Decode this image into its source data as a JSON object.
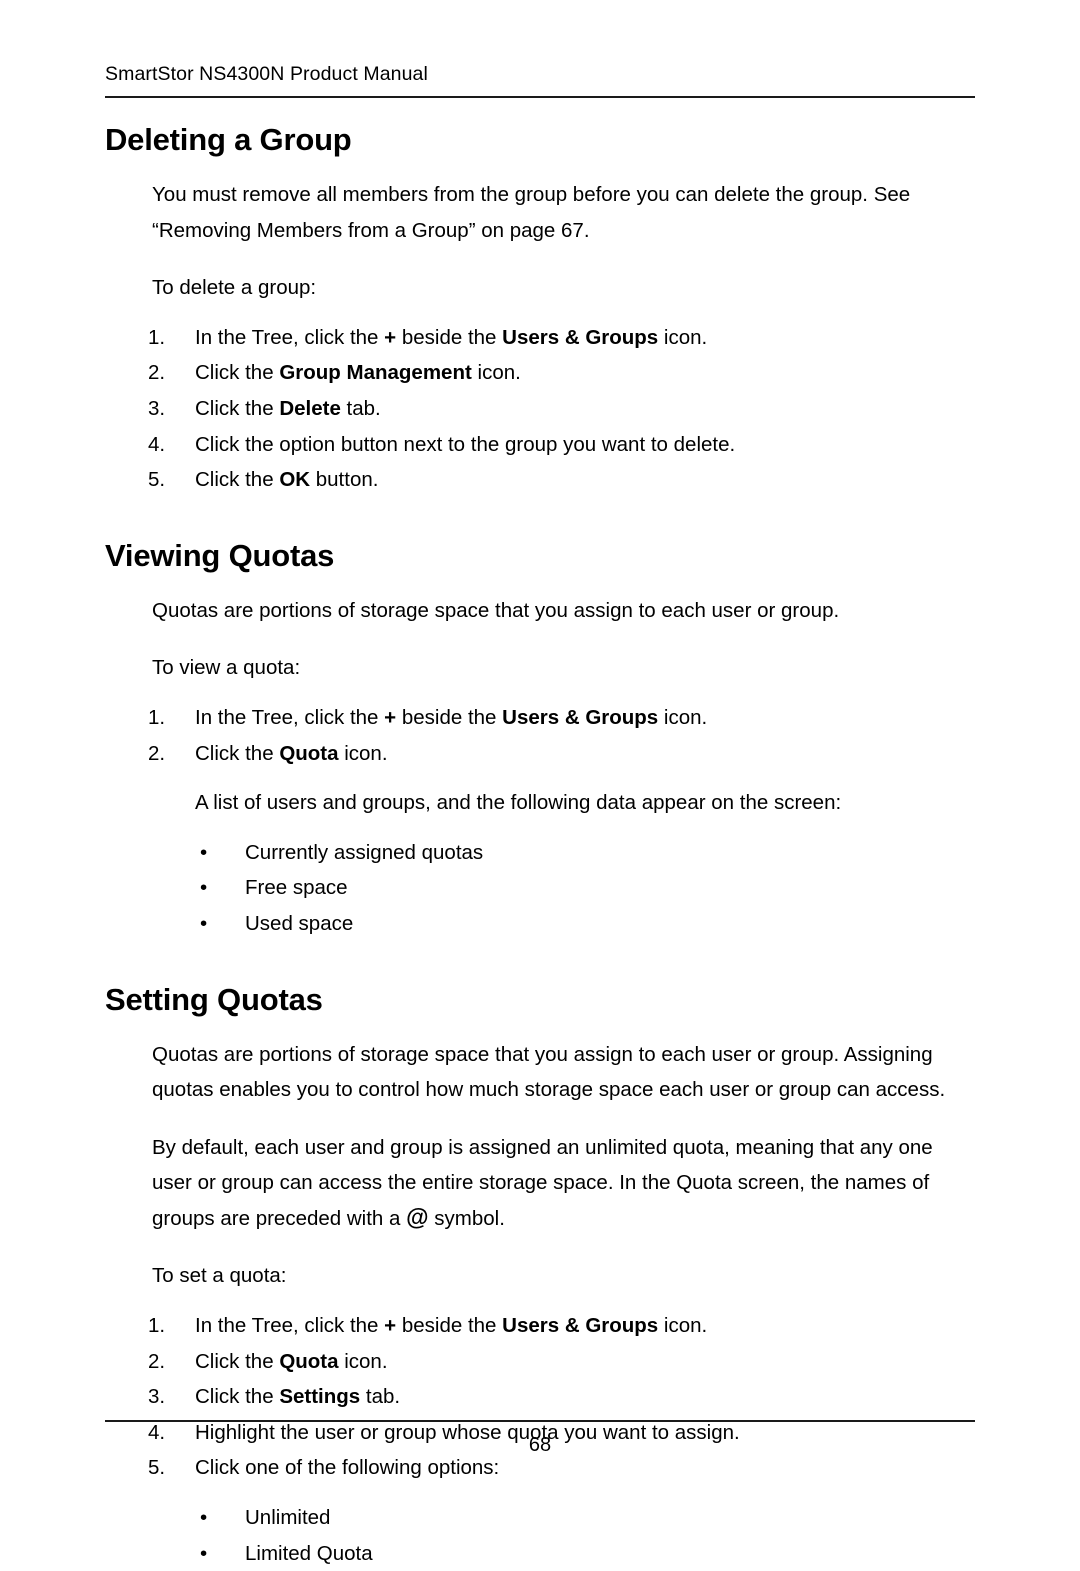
{
  "header": {
    "running_title": "SmartStor NS4300N Product Manual"
  },
  "footer": {
    "page_number": "68"
  },
  "sections": [
    {
      "heading": "Deleting a Group",
      "intro": "You must remove all members from the group before you can delete the group. See “Removing Members from a Group” on page 67.",
      "lead_in": "To delete a group:",
      "steps": [
        {
          "num": "1.",
          "pre": "In the Tree, click the ",
          "bold": "+",
          "mid": " beside the ",
          "bold2": "Users & Groups",
          "post": " icon."
        },
        {
          "num": "2.",
          "pre": "Click the ",
          "bold": "Group Management",
          "post": " icon."
        },
        {
          "num": "3.",
          "pre": "Click the ",
          "bold": "Delete",
          "post": " tab."
        },
        {
          "num": "4.",
          "pre": "Click the option button next to the group you want to delete.",
          "bold": "",
          "post": ""
        },
        {
          "num": "5.",
          "pre": "Click the ",
          "bold": "OK",
          "post": " button."
        }
      ]
    },
    {
      "heading": "Viewing Quotas",
      "intro": "Quotas are portions of storage space that you assign to each user or group.",
      "lead_in": "To view a quota:",
      "steps": [
        {
          "num": "1.",
          "pre": "In the Tree, click the ",
          "bold": "+",
          "mid": " beside the ",
          "bold2": "Users & Groups",
          "post": " icon."
        },
        {
          "num": "2.",
          "pre": "Click the ",
          "bold": "Quota",
          "post": " icon."
        }
      ],
      "note": "A list of users and groups, and the following data appear on the screen:",
      "bullets": [
        "Currently assigned quotas",
        "Free space",
        "Used space"
      ]
    },
    {
      "heading": "Setting Quotas",
      "intro": "Quotas are portions of storage space that you assign to each user or group. Assigning quotas enables you to control how much storage space each user or group can access.",
      "para2_pre": "By default, each user and group is assigned an unlimited quota, meaning that any one user or group can access the entire storage space. In the Quota screen, the names of groups are preceded with a ",
      "para2_symbol": "@",
      "para2_post": " symbol.",
      "lead_in": "To set a quota:",
      "steps": [
        {
          "num": "1.",
          "pre": "In the Tree, click the ",
          "bold": "+",
          "mid": " beside the ",
          "bold2": "Users & Groups",
          "post": " icon."
        },
        {
          "num": "2.",
          "pre": "Click the ",
          "bold": "Quota",
          "post": " icon."
        },
        {
          "num": "3.",
          "pre": "Click the ",
          "bold": "Settings",
          "post": " tab."
        },
        {
          "num": "4.",
          "pre": "Highlight the user or group whose quota you want to assign.",
          "bold": "",
          "post": ""
        },
        {
          "num": "5.",
          "pre": "Click one of the following options:",
          "bold": "",
          "post": ""
        }
      ],
      "bullets": [
        "Unlimited",
        "Limited Quota"
      ]
    }
  ],
  "bullet_glyph": "•"
}
